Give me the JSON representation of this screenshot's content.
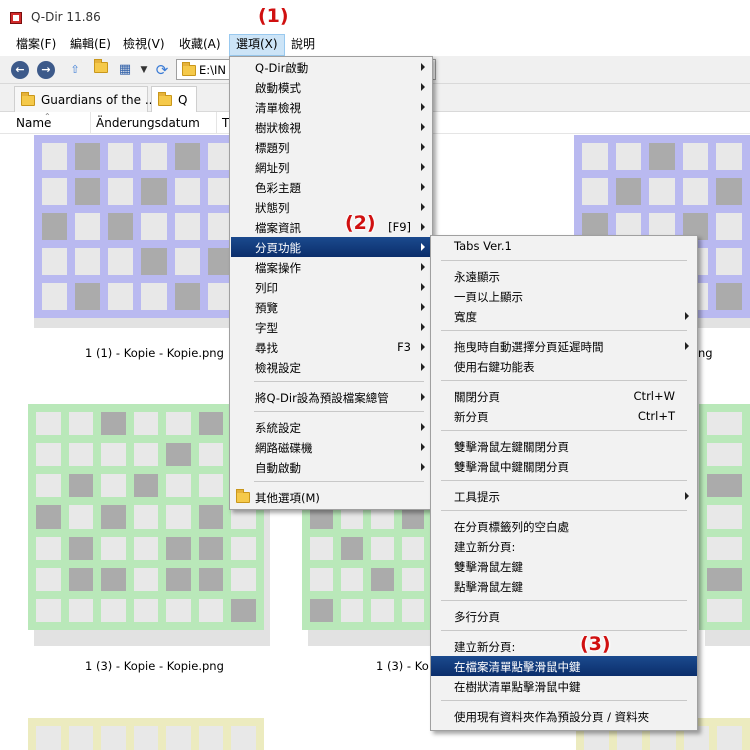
{
  "window": {
    "title": "Q-Dir 11.86"
  },
  "menubar": {
    "items": [
      "檔案(F)",
      "編輯(E)",
      "檢視(V)",
      "收藏(A)",
      "選項(X)",
      "說明"
    ]
  },
  "toolbar": {
    "address": "E:\\IN"
  },
  "tabs": [
    "Guardians of the ...",
    "Q"
  ],
  "columns": [
    "Name",
    "Änderungsdatum",
    "T"
  ],
  "files": [
    "1 (1) - Kopie - Kopie.png",
    "ng",
    "1 (3) - Kopie - Kopie.png",
    "1 (3) - Ko"
  ],
  "options_menu": [
    {
      "label": "Q-Dir啟動",
      "submenu": true
    },
    {
      "label": "啟動模式",
      "submenu": true
    },
    {
      "label": "清單檢視",
      "submenu": true
    },
    {
      "label": "樹狀檢視",
      "submenu": true
    },
    {
      "label": "標題列",
      "submenu": true
    },
    {
      "label": "網址列",
      "submenu": true
    },
    {
      "label": "色彩主題",
      "submenu": true
    },
    {
      "label": "狀態列",
      "submenu": true
    },
    {
      "label": "檔案資訊",
      "shortcut": "[F9]",
      "submenu": true
    },
    {
      "label": "分頁功能",
      "submenu": true,
      "highlighted": true
    },
    {
      "label": "檔案操作",
      "submenu": true
    },
    {
      "label": "列印",
      "submenu": true
    },
    {
      "label": "預覽",
      "submenu": true
    },
    {
      "label": "字型",
      "submenu": true
    },
    {
      "label": "尋找",
      "shortcut": "F3",
      "submenu": true
    },
    {
      "label": "檢視設定",
      "submenu": true
    },
    {
      "separator": true
    },
    {
      "label": "將Q-Dir設為預設檔案總管",
      "submenu": true
    },
    {
      "separator": true
    },
    {
      "label": "系統設定",
      "submenu": true
    },
    {
      "label": "網路磁碟機",
      "submenu": true
    },
    {
      "label": "自動啟動",
      "submenu": true
    },
    {
      "separator": true
    },
    {
      "label": "其他選項(M)",
      "icon": "folder-icon"
    }
  ],
  "tabs_submenu": [
    {
      "label": "Tabs Ver.1"
    },
    {
      "separator": true
    },
    {
      "label": "永遠顯示"
    },
    {
      "label": "一頁以上顯示"
    },
    {
      "label": "寬度",
      "submenu": true
    },
    {
      "separator": true
    },
    {
      "label": "拖曳時自動選擇分頁延遲時間",
      "submenu": true
    },
    {
      "label": "使用右鍵功能表"
    },
    {
      "separator": true
    },
    {
      "label": "關閉分頁",
      "shortcut": "Ctrl+W"
    },
    {
      "label": "新分頁",
      "shortcut": "Ctrl+T"
    },
    {
      "separator": true
    },
    {
      "label": "雙擊滑鼠左鍵關閉分頁"
    },
    {
      "label": "雙擊滑鼠中鍵關閉分頁"
    },
    {
      "separator": true
    },
    {
      "label": "工具提示",
      "submenu": true
    },
    {
      "separator": true
    },
    {
      "label": "在分頁標籤列的空白處"
    },
    {
      "label": "建立新分頁:"
    },
    {
      "label": "雙擊滑鼠左鍵"
    },
    {
      "label": "點擊滑鼠左鍵"
    },
    {
      "separator": true
    },
    {
      "label": "多行分頁"
    },
    {
      "separator": true
    },
    {
      "label": "建立新分頁:"
    },
    {
      "label": "在檔案清單點擊滑鼠中鍵",
      "highlighted": true
    },
    {
      "label": "在樹狀清單點擊滑鼠中鍵"
    },
    {
      "separator": true
    },
    {
      "label": "使用現有資料夾作為預設分頁 / 資料夾"
    }
  ],
  "callouts": [
    "(1)",
    "(2)",
    "(3)"
  ],
  "colors": {
    "menu_highlight": "#0b2e6b",
    "callout": "#d01010",
    "thumb_blue": "#b9b9f0",
    "thumb_green": "#b9e8b9",
    "thumb_yellow": "#ecebbf",
    "thumb_cell_light": "#e8e8e8",
    "thumb_cell_dark": "#ababab"
  }
}
